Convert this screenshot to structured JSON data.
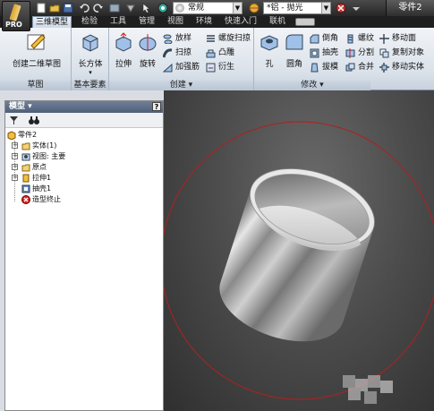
{
  "quick_access": {
    "app_label": "PRO",
    "style_combo": "常规",
    "material_combo": "*铝 - 抛光",
    "document_title": "零件2"
  },
  "tabs": [
    {
      "label": "三维模型",
      "active": true
    },
    {
      "label": "检验",
      "active": false
    },
    {
      "label": "工具",
      "active": false
    },
    {
      "label": "管理",
      "active": false
    },
    {
      "label": "视图",
      "active": false
    },
    {
      "label": "环境",
      "active": false
    },
    {
      "label": "快速入门",
      "active": false
    },
    {
      "label": "联机",
      "active": false
    }
  ],
  "ribbon": {
    "sketch_panel": {
      "title": "草图",
      "create_sketch": "创建二维草图"
    },
    "primitives_panel": {
      "title": "基本要素",
      "box": "长方体"
    },
    "create_panel": {
      "title": "创建 ▾",
      "extrude": "拉伸",
      "revolve": "旋转",
      "loft": "放样",
      "sweep": "扫掠",
      "rib": "加强筋",
      "coil": "螺旋扫掠",
      "emboss": "凸雕",
      "derive": "衍生"
    },
    "modify_panel": {
      "title": "修改 ▾",
      "hole": "孔",
      "fillet": "圆角",
      "chamfer": "倒角",
      "shell": "抽壳",
      "draft": "拔模",
      "thread": "螺纹",
      "split": "分割",
      "combine": "合并",
      "move_face": "移动面",
      "copy_object": "复制对象",
      "move_body": "移动实体"
    }
  },
  "browser": {
    "title": "模型 ▾",
    "help": "?",
    "tree": [
      {
        "label": "零件2",
        "level": 0,
        "icon": "part-icon"
      },
      {
        "label": "实体(1)",
        "level": 1,
        "icon": "solid-bodies-icon",
        "expandable": true
      },
      {
        "label": "视图: 主要",
        "level": 1,
        "icon": "view-icon",
        "expandable": true
      },
      {
        "label": "原点",
        "level": 1,
        "icon": "origin-folder-icon",
        "expandable": true
      },
      {
        "label": "拉伸1",
        "level": 1,
        "icon": "extrude-feature-icon",
        "expandable": true
      },
      {
        "label": "抽壳1",
        "level": 1,
        "icon": "shell-feature-icon",
        "expandable": false
      },
      {
        "label": "造型终止",
        "level": 1,
        "icon": "end-of-part-icon",
        "expandable": false
      }
    ]
  },
  "colors": {
    "annotation_circle": "#b02020",
    "viewport_bg": "#4d4d4d",
    "ribbon_bg": "#dbe2ea"
  }
}
